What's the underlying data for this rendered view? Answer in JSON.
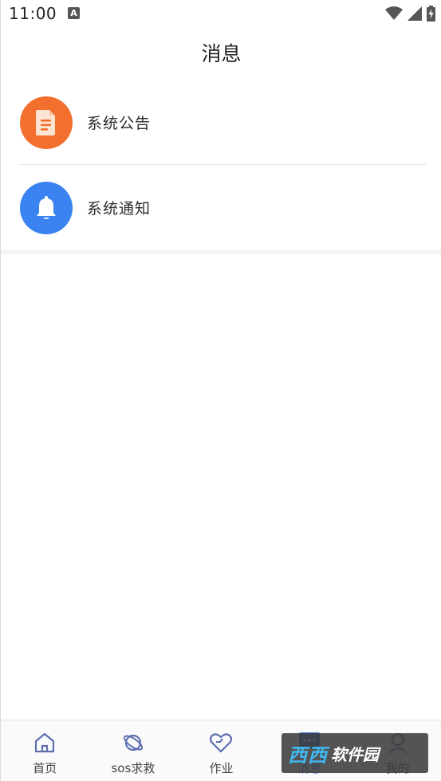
{
  "status_bar": {
    "time": "11:00",
    "notification_letter": "A"
  },
  "header": {
    "title": "消息"
  },
  "messages": [
    {
      "label": "系统公告",
      "icon": "document-icon",
      "color": "#f26f2e"
    },
    {
      "label": "系统通知",
      "icon": "bell-icon",
      "color": "#3a83f1"
    }
  ],
  "tabs": [
    {
      "label": "首页",
      "icon": "home-icon"
    },
    {
      "label": "sos求救",
      "icon": "planet-icon"
    },
    {
      "label": "作业",
      "icon": "heart-icon"
    },
    {
      "label": "消息",
      "icon": "message-icon",
      "active": true
    },
    {
      "label": "我的",
      "icon": "user-icon"
    }
  ],
  "watermark": {
    "brand": "西西",
    "suffix": "软件园"
  },
  "colors": {
    "accent": "#3a6fd8",
    "orange": "#f26f2e",
    "blue": "#3a83f1"
  }
}
